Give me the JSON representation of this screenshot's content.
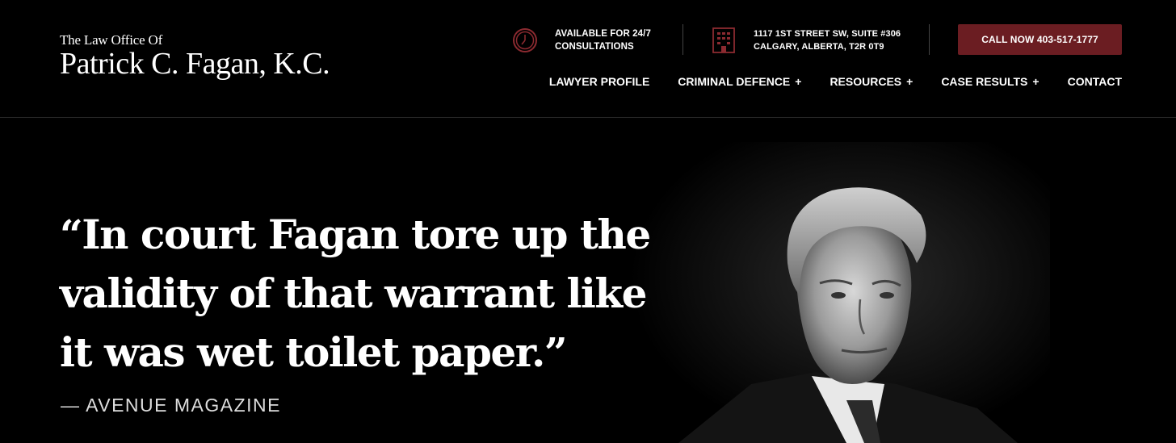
{
  "header": {
    "logo": {
      "line1": "The Law Office Of",
      "line2": "Patrick C. Fagan, K.C."
    },
    "availability": {
      "icon": "clock-icon",
      "line1": "AVAILABLE FOR 24/7",
      "line2": "CONSULTATIONS"
    },
    "address": {
      "icon": "building-icon",
      "line1": "1117 1ST STREET SW, SUITE #306",
      "line2": "CALGARY, ALBERTA, T2R 0T9"
    },
    "cta_label": "CALL NOW 403-517-1777",
    "colors": {
      "accent": "#6b1d22",
      "icon": "#8b2a30"
    }
  },
  "nav": {
    "lawyer_profile": "LAWYER PROFILE",
    "criminal_defence": "CRIMINAL DEFENCE",
    "resources": "RESOURCES",
    "case_results": "CASE RESULTS",
    "contact": "CONTACT",
    "expand_symbol": "+"
  },
  "hero": {
    "quote_line1": "“In court Fagan tore up the",
    "quote_line2": "validity of that warrant like",
    "quote_line3": "it was wet toilet paper.”",
    "attribution": "— AVENUE MAGAZINE"
  }
}
